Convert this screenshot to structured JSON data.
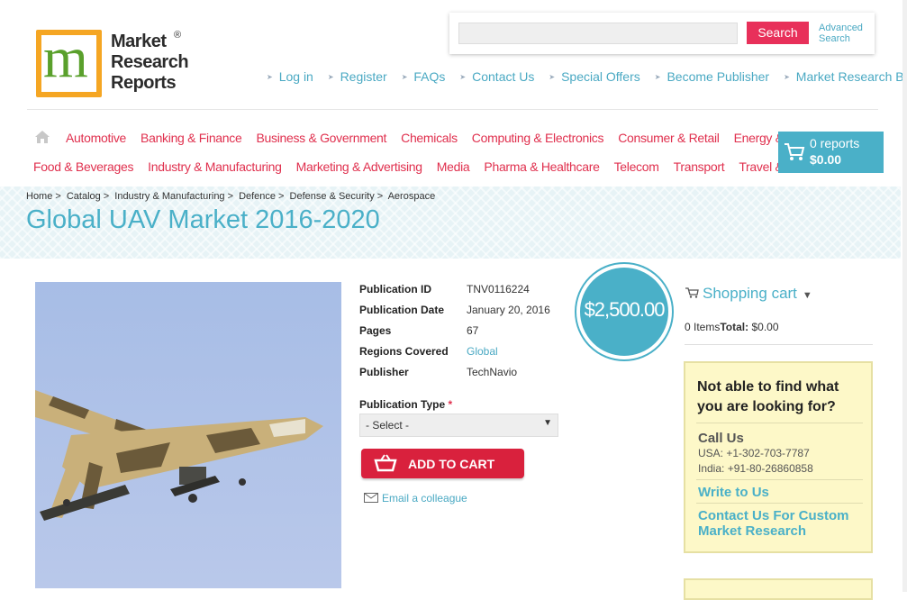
{
  "logo": {
    "line1": "Market",
    "line2": "Research",
    "line3": "Reports",
    "reg": "®"
  },
  "search": {
    "button": "Search",
    "advanced_line1": "Advanced",
    "advanced_line2": "Search"
  },
  "toplinks": [
    "Log in",
    "Register",
    "FAQs",
    "Contact Us",
    "Special Offers",
    "Become Publisher",
    "Market Research Blog"
  ],
  "categories_row1": [
    "Automotive",
    "Banking & Finance",
    "Business & Government",
    "Chemicals",
    "Computing & Electronics",
    "Consumer & Retail",
    "Energy & Utilities"
  ],
  "categories_row2": [
    "Food & Beverages",
    "Industry & Manufacturing",
    "Marketing & Advertising",
    "Media",
    "Pharma & Healthcare",
    "Telecom",
    "Transport",
    "Travel & Leisure"
  ],
  "cart_button": {
    "count": "0 reports",
    "total": "$0.00"
  },
  "breadcrumb": [
    "Home",
    ">",
    "Catalog",
    ">",
    "Industry & Manufacturing",
    ">",
    "Defence",
    ">",
    "Defense & Security",
    ">",
    "Aerospace"
  ],
  "page_title": "Global UAV Market 2016-2020",
  "details": {
    "publication_id_label": "Publication ID",
    "publication_id": "TNV0116224",
    "publication_date_label": "Publication Date",
    "publication_date": "January 20, 2016",
    "pages_label": "Pages",
    "pages": "67",
    "regions_label": "Regions Covered",
    "regions": "Global",
    "publisher_label": "Publisher",
    "publisher": "TechNavio"
  },
  "price": "$2,500.00",
  "publication_type": {
    "label": "Publication Type",
    "required": "*",
    "selected": "- Select -"
  },
  "add_to_cart": "ADD TO CART",
  "email_colleague": "Email a colleague",
  "shopping_cart": {
    "title": "Shopping cart",
    "items": "0 Items",
    "total_label": "Total:",
    "total": "$0.00"
  },
  "help": {
    "title": "Not able to find what you are looking for?",
    "call_us": "Call Us",
    "usa": "USA: +1-302-703-7787",
    "india": "India: +91-80-26860858",
    "write": "Write to Us",
    "custom": "Contact Us For Custom Market Research"
  }
}
